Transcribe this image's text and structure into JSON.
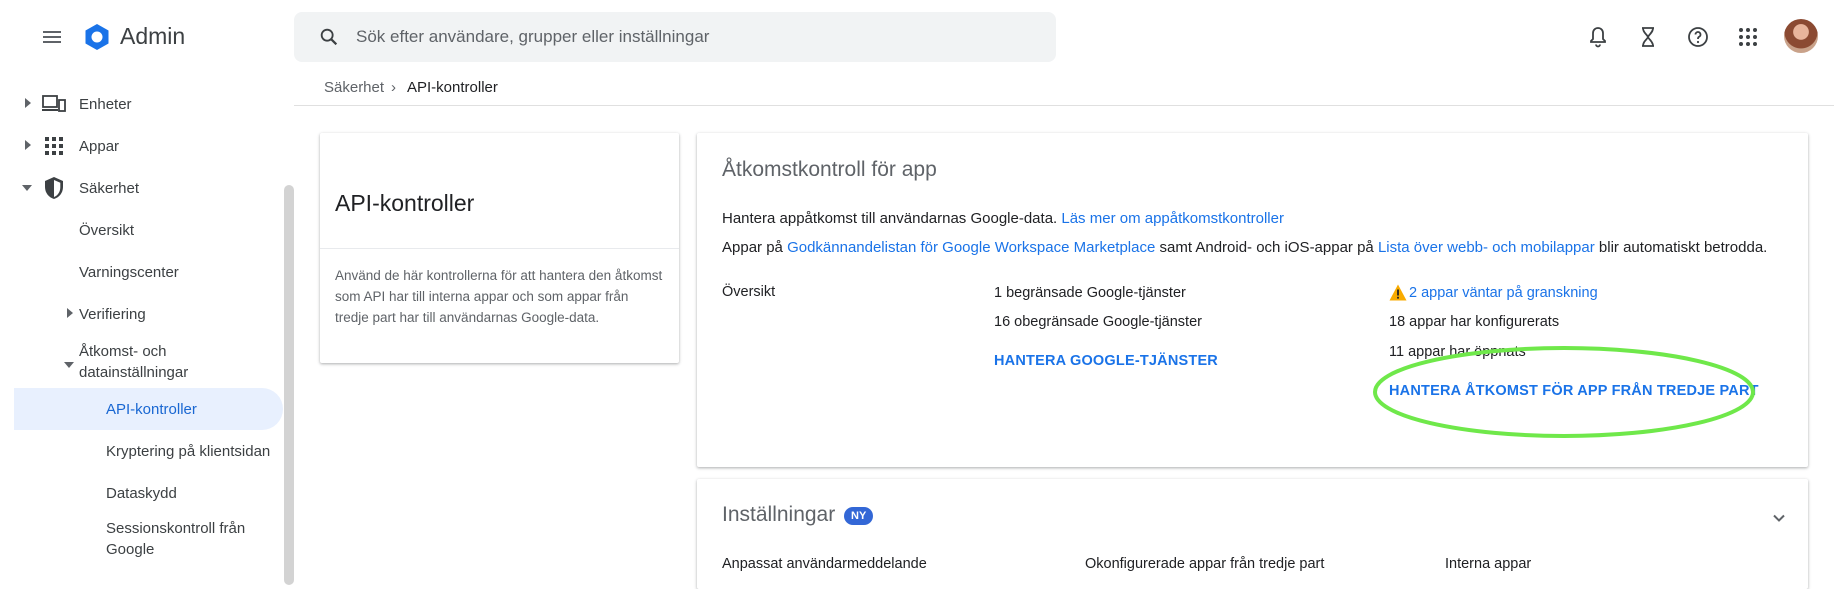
{
  "app": {
    "title": "Admin",
    "search_placeholder": "Sök efter användare, grupper eller inställningar"
  },
  "sidebar": {
    "items": [
      {
        "label": "Enheter"
      },
      {
        "label": "Appar"
      },
      {
        "label": "Säkerhet"
      },
      {
        "label": "Översikt"
      },
      {
        "label": "Varningscenter"
      },
      {
        "label": "Verifiering"
      },
      {
        "label": "Åtkomst- och",
        "label2": "datainställningar"
      },
      {
        "label": "API-kontroller"
      },
      {
        "label": "Kryptering på klientsidan"
      },
      {
        "label": "Dataskydd"
      },
      {
        "label": "Sessionskontroll från",
        "label2": "Google"
      }
    ]
  },
  "breadcrumb": {
    "parent": "Säkerhet",
    "separator": "›",
    "current": "API-kontroller"
  },
  "left_card": {
    "title": "API-kontroller",
    "description": "Använd de här kontrollerna för att hantera den åtkomst som API har till interna appar och som appar från tredje part har till användarnas Google-data."
  },
  "access_card": {
    "title": "Åtkomstkontroll för app",
    "line1_text": "Hantera appåtkomst till användarnas Google-data.",
    "line1_link": "Läs mer om appåtkomstkontroller",
    "line2_a": "Appar på",
    "line2_link1": "Godkännandelistan för Google Workspace Marketplace",
    "line2_b": "samt Android- och iOS-appar på",
    "line2_link2": "Lista över webb- och mobilappar",
    "line2_c": "blir automatiskt betrodda.",
    "overview_label": "Översikt",
    "col1": [
      "1 begränsade Google-tjänster",
      "16 obegränsade Google-tjänster"
    ],
    "col1_action": "HANTERA GOOGLE-TJÄNSTER",
    "warning_link": "2 appar väntar på granskning",
    "col2": [
      "18 appar har konfigurerats",
      "11 appar har öppnats"
    ],
    "col2_action": "HANTERA ÅTKOMST FÖR APP FRÅN TREDJE PART"
  },
  "settings_card": {
    "title": "Inställningar",
    "badge": "NY",
    "cols": [
      "Anpassat användarmeddelande",
      "Okonfigurerade appar från tredje part",
      "Interna appar"
    ]
  },
  "colors": {
    "accent": "#1a73e8",
    "highlight_circle": "#6fe84a",
    "warning": "#f9ab00"
  }
}
